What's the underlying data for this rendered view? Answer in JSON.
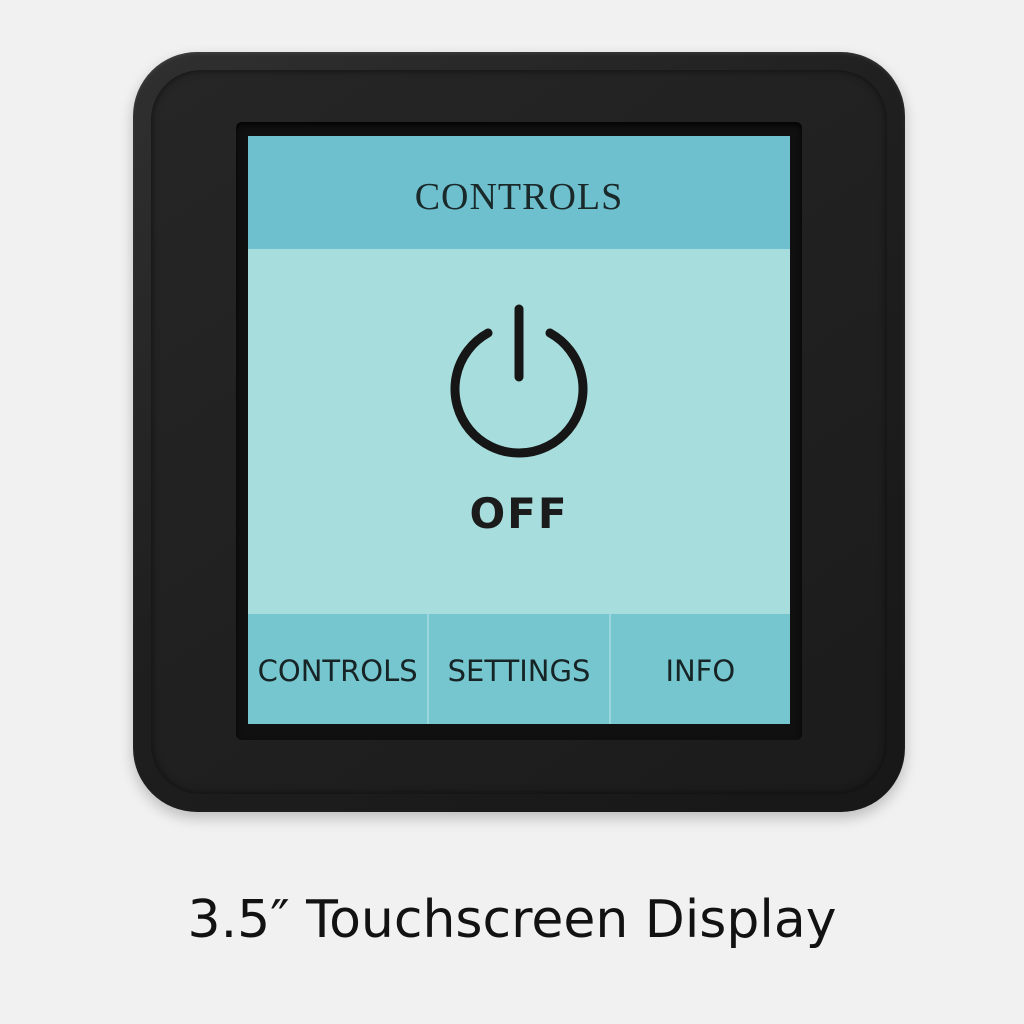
{
  "screen": {
    "header_title": "CONTROLS",
    "power_state": "OFF",
    "power_icon": "power-icon",
    "tabs": [
      {
        "label": "CONTROLS"
      },
      {
        "label": "SETTINGS"
      },
      {
        "label": "INFO"
      }
    ]
  },
  "caption": "3.5″ Touchscreen Display",
  "colors": {
    "header": "#6fc0cf",
    "body": "#a7dedd",
    "tabbar": "#76c6cf",
    "bezel": "#1f1f1f",
    "background": "#f1f1f1"
  }
}
